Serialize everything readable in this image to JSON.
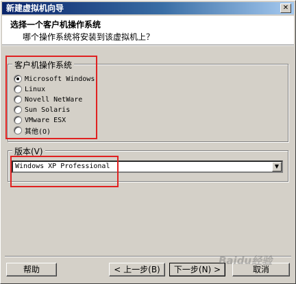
{
  "window": {
    "title": "新建虚拟机向导",
    "close_glyph": "✕"
  },
  "header": {
    "title": "选择一个客户机操作系统",
    "subtitle": "哪个操作系统将安装到该虚拟机上？"
  },
  "guest_os": {
    "group_label": "客户机操作系统",
    "options": [
      {
        "label": "Microsoft Windows",
        "checked": true
      },
      {
        "label": "Linux",
        "checked": false
      },
      {
        "label": "Novell NetWare",
        "checked": false
      },
      {
        "label": "Sun Solaris",
        "checked": false
      },
      {
        "label": "VMware ESX",
        "checked": false
      },
      {
        "label": "其他(O)",
        "checked": false
      }
    ]
  },
  "version": {
    "group_label": "版本(V)",
    "selected": "Windows XP Professional"
  },
  "buttons": {
    "help": "帮助",
    "back": "< 上一步(B)",
    "next": "下一步(N) >",
    "cancel": "取消"
  },
  "watermark": "Baidu经验"
}
